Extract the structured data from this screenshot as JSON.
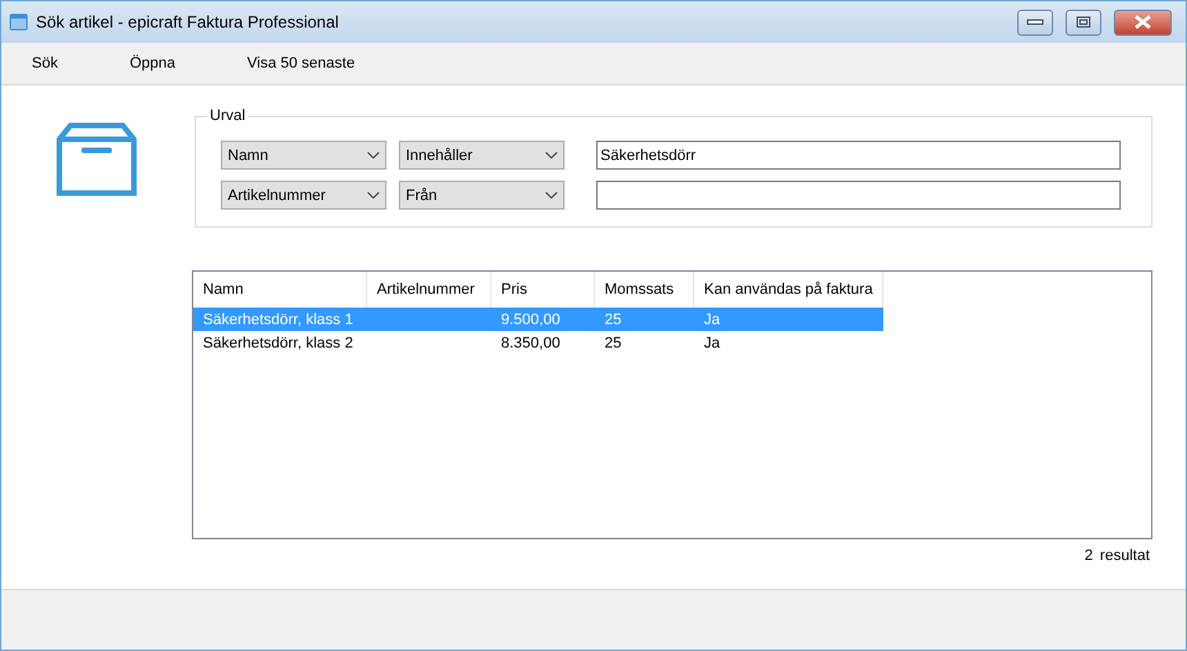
{
  "window": {
    "title": "Sök artikel - epicraft Faktura Professional"
  },
  "menu": [
    "Sök",
    "Öppna",
    "Visa 50 senaste"
  ],
  "filter": {
    "title": "Urval",
    "rows": [
      {
        "field": "Namn",
        "operator": "Innehåller",
        "value": "Säkerhetsdörr"
      },
      {
        "field": "Artikelnummer",
        "operator": "Från",
        "value": ""
      }
    ]
  },
  "table": {
    "columns": [
      "Namn",
      "Artikelnummer",
      "Pris",
      "Momssats",
      "Kan användas på faktura"
    ],
    "rows": [
      {
        "cells": [
          "Säkerhetsdörr, klass 1",
          "",
          "9.500,00",
          "25",
          "Ja"
        ],
        "selected": true
      },
      {
        "cells": [
          "Säkerhetsdörr, klass 2",
          "",
          "8.350,00",
          "25",
          "Ja"
        ],
        "selected": false
      }
    ]
  },
  "result": {
    "count": "2",
    "label": "resultat"
  }
}
